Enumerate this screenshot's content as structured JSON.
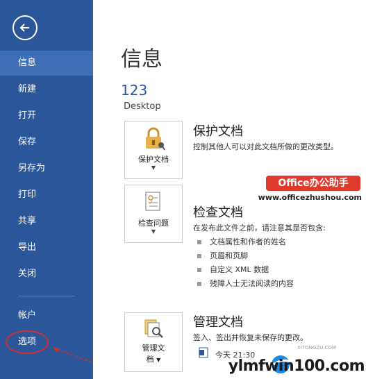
{
  "sidebar": {
    "items": [
      {
        "id": "info",
        "label": "信息",
        "active": true
      },
      {
        "id": "new",
        "label": "新建"
      },
      {
        "id": "open",
        "label": "打开"
      },
      {
        "id": "save",
        "label": "保存"
      },
      {
        "id": "save_as",
        "label": "另存为"
      },
      {
        "id": "print",
        "label": "打印"
      },
      {
        "id": "share",
        "label": "共享"
      },
      {
        "id": "export",
        "label": "导出"
      },
      {
        "id": "close",
        "label": "关闭"
      },
      {
        "id": "account",
        "label": "帐户"
      },
      {
        "id": "options",
        "label": "选项"
      }
    ]
  },
  "main": {
    "title": "信息",
    "doc_name": "123",
    "doc_location": "Desktop",
    "protect": {
      "button_label": "保护文档",
      "title": "保护文档",
      "desc": "控制其他人可以对此文档所做的更改类型。"
    },
    "inspect": {
      "button_label": "检查问题",
      "title": "检查文档",
      "desc": "在发布此文件之前，请注意其是否包含:",
      "bullets": [
        "文档属性和作者的姓名",
        "页眉和页脚",
        "自定义 XML 数据",
        "残障人士无法阅读的内容"
      ]
    },
    "manage": {
      "button_label_1": "管理文",
      "button_label_2": "档",
      "title": "管理文档",
      "desc": "签入、签出并恢复未保存的更改。",
      "recent": "今天 21:30"
    }
  },
  "branding": {
    "badge": "Office办公助手",
    "url": "www.officezhushou.com",
    "watermark": "ylmfwin100.com",
    "watermark_sub": "XITONGZU.COM",
    "badge_color": "#e03a2f"
  },
  "colors": {
    "sidebar": "#2b579a",
    "active": "#3e6eb5",
    "accent": "#2b579a"
  }
}
